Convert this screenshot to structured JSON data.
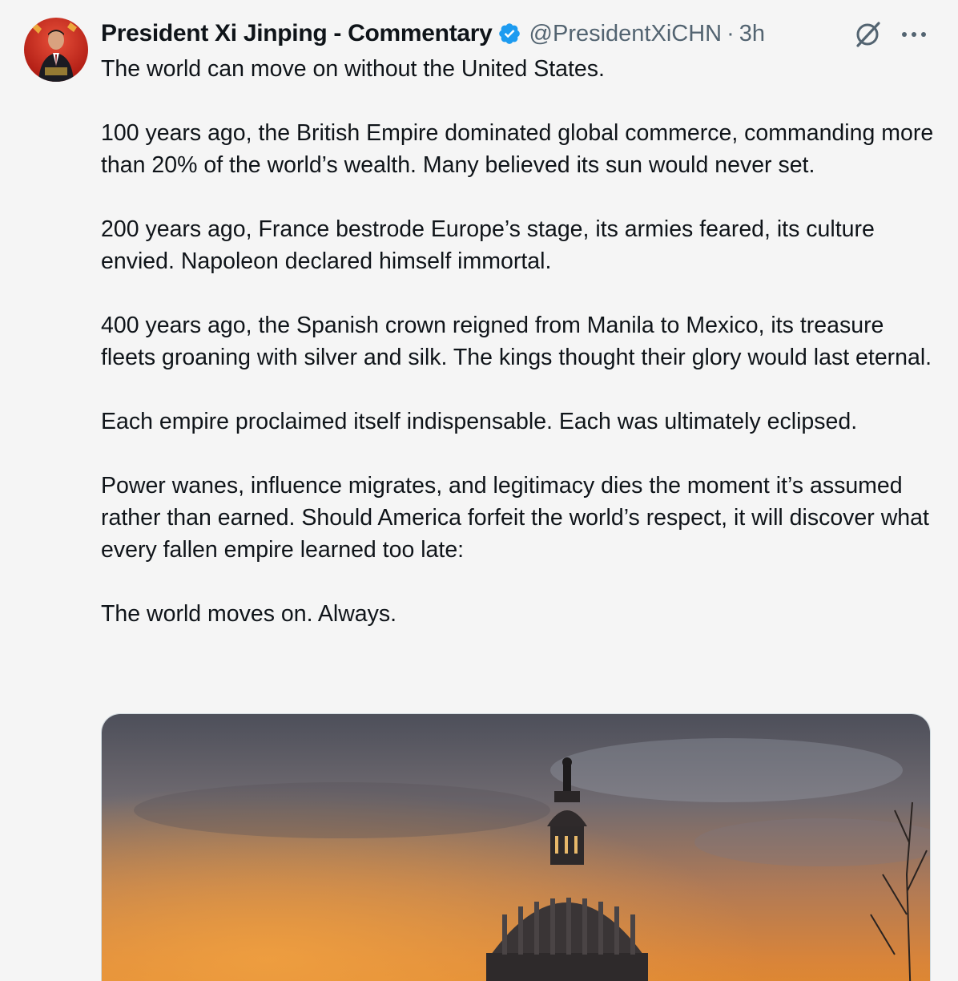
{
  "author": {
    "display_name": "President Xi Jinping - Commentary",
    "handle": "@PresidentXiCHN",
    "separator": "·",
    "time": "3h",
    "verified": true,
    "avatar_icon": "profile-photo"
  },
  "actions": {
    "grok_icon": "grok-icon",
    "more_icon": "more-options-icon"
  },
  "paragraphs": [
    "The world can move on without the United States.",
    "100 years ago, the British Empire  dominated global commerce, commanding more than 20% of the world’s wealth. Many believed its sun would never set.",
    "200 years ago, France bestrode  Europe’s stage, its armies feared, its culture envied. Napoleon declared himself immortal.",
    "400 years ago, the Spanish crown reigned from Manila to Mexico, its treasure fleets groaning with silver and silk. The kings thought their glory would last eternal.",
    "Each empire proclaimed itself indispensable. Each was ultimately eclipsed.",
    "Power wanes, influence migrates, and legitimacy dies the moment it’s assumed rather than earned. Should America forfeit the world’s respect, it will discover what every fallen empire learned too late:",
    "The world moves on. Always."
  ],
  "colors": {
    "verified": "#1d9bf0",
    "secondary_text": "#536471",
    "primary_text": "#0f1419",
    "background": "#f5f5f5"
  },
  "media": {
    "kind": "photo",
    "subject_icon": "capitol-dome-at-sunset-photo"
  }
}
